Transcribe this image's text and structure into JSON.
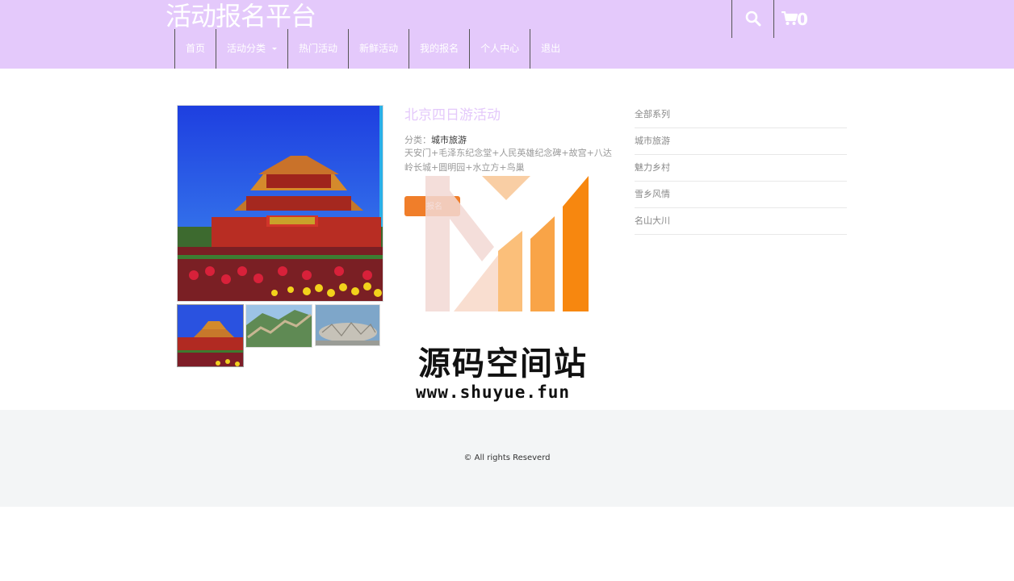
{
  "header": {
    "brand": "活动报名平台",
    "cart_count": "0",
    "nav": [
      {
        "label": "首页"
      },
      {
        "label": "活动分类"
      },
      {
        "label": "热门活动"
      },
      {
        "label": "新鲜活动"
      },
      {
        "label": "我的报名"
      },
      {
        "label": "个人中心"
      },
      {
        "label": "退出"
      }
    ]
  },
  "icons": {
    "search": "search-icon",
    "cart": "cart-icon",
    "dropdown": "caret-down-icon"
  },
  "product": {
    "title": "北京四日游活动",
    "category_label": "分类：",
    "category_value": "城市旅游",
    "description": "天安门+毛泽东纪念堂+人民英雄纪念碑+故宫+八达岭长城+圆明园+水立方+鸟巢",
    "signup_label": "报名"
  },
  "sidebar": {
    "categories": [
      "全部系列",
      "城市旅游",
      "魅力乡村",
      "雪乡风情",
      "名山大川"
    ]
  },
  "watermark": {
    "title": "源码空间站",
    "url": "www.shuyue.fun"
  },
  "footer": {
    "copyright": "© All rights Reseverd"
  },
  "colors": {
    "header_bg": "#e4c9fb",
    "title_color": "#e4c9fb",
    "button": "#f07e2a",
    "footer_bg": "#f3f5f6"
  }
}
